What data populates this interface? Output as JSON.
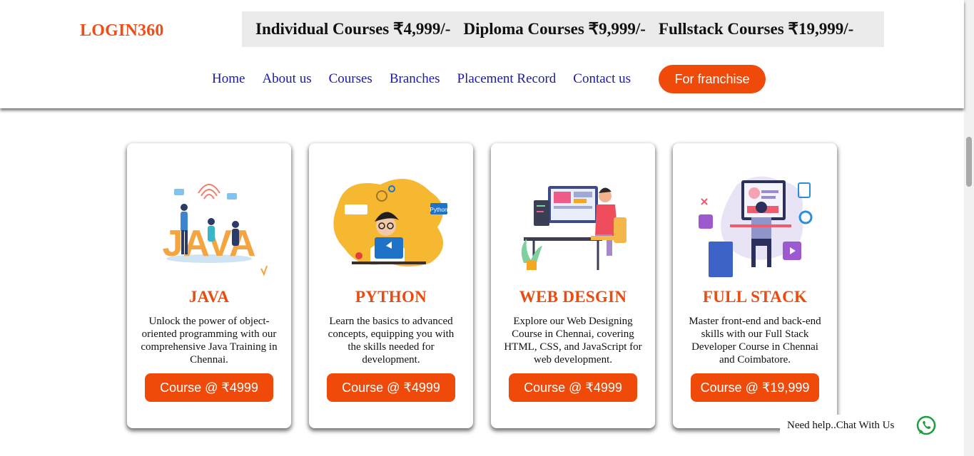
{
  "header": {
    "logo": "LOGIN360",
    "banner": [
      "Individual Courses ₹4,999/-",
      "Diploma Courses ₹9,999/-",
      "Fullstack Courses ₹19,999/-"
    ],
    "nav": [
      "Home",
      "About us",
      "Courses",
      "Branches",
      "Placement Record",
      "Contact us"
    ],
    "franchise_label": "For franchise"
  },
  "courses": [
    {
      "title": "JAVA",
      "description": "Unlock the power of object-oriented programming with our comprehensive Java Training in Chennai.",
      "button": "Course @ ₹4999",
      "image_text": "JAVA"
    },
    {
      "title": "PYTHON",
      "description": "Learn the basics to advanced concepts, equipping you with the skills needed for development.",
      "button": "Course @ ₹4999",
      "image_text": "Python"
    },
    {
      "title": "WEB DESGIN",
      "description": "Explore our Web Designing Course in Chennai, covering HTML, CSS, and JavaScript for web development.",
      "button": "Course @ ₹4999"
    },
    {
      "title": "FULL STACK",
      "description": "Master front-end and back-end skills with our Full Stack Developer Course in Chennai and Coimbatore.",
      "button": "Course @ ₹19,999"
    }
  ],
  "chat": {
    "label": "Need help..Chat With Us",
    "icon": "whatsapp-icon"
  },
  "colors": {
    "accent": "#f04a0a",
    "nav": "#1a1aa6",
    "banner_bg": "#ebebeb"
  }
}
